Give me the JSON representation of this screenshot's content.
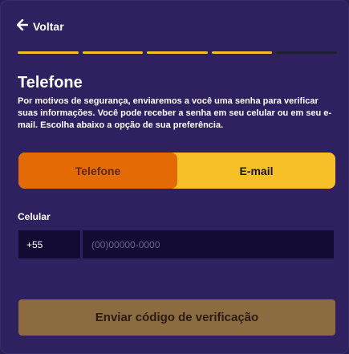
{
  "header": {
    "back_label": "Voltar"
  },
  "progress": {
    "total_steps": 5,
    "completed_steps": 4,
    "accent_color": "#f7c028"
  },
  "main": {
    "title": "Telefone",
    "description": "Por motivos de segurança, enviaremos a você uma senha para verificar suas informações. Você pode receber a senha em seu celular ou em seu e-mail. Escolha abaixo a opção de sua preferência.",
    "toggle": {
      "options": [
        {
          "label": "Telefone",
          "selected": true
        },
        {
          "label": "E-mail",
          "selected": false
        }
      ]
    },
    "phone": {
      "label": "Celular",
      "country_code": "+55",
      "number_value": "",
      "number_placeholder": "(00)00000-0000"
    },
    "submit_label": "Enviar código de verificação"
  },
  "colors": {
    "background": "#2f215f",
    "selected_option": "#e46a06",
    "unselected_option": "#f7c028",
    "input_bg": "#150a33",
    "submit_bg": "#8b6b40"
  }
}
